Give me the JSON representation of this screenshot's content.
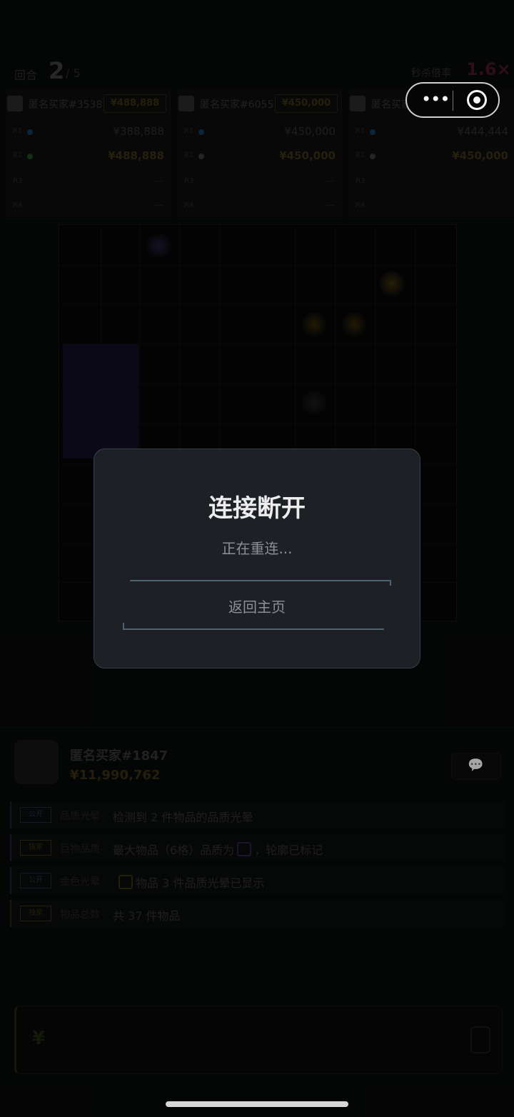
{
  "header": {
    "round_label": "回合",
    "round_current": "2",
    "round_total": "/ 5",
    "multiplier_label": "秒杀倍率",
    "multiplier_value": "1.6×"
  },
  "buyers": [
    {
      "name": "匿名买家#3538",
      "bid": "¥488,888",
      "rows": [
        {
          "label": "R1",
          "value": "¥388,888",
          "dot_color": "#0f3a5a"
        },
        {
          "label": "R2",
          "value": "¥488,888",
          "dot_color": "#1a4a1a"
        },
        {
          "label": "R3",
          "value": "—"
        },
        {
          "label": "R4",
          "value": "—"
        }
      ]
    },
    {
      "name": "匿名买家#6055",
      "bid": "¥450,000",
      "rows": [
        {
          "label": "R1",
          "value": "¥450,000",
          "dot_color": "#0f3a5a"
        },
        {
          "label": "R2",
          "value": "¥450,000",
          "dot_color": "#3a3a3a"
        },
        {
          "label": "R3",
          "value": "—"
        },
        {
          "label": "R4",
          "value": "—"
        }
      ]
    },
    {
      "name": "匿名买家",
      "bid": "",
      "rows": [
        {
          "label": "R1",
          "value": "¥444,444",
          "dot_color": "#0f3a5a"
        },
        {
          "label": "R2",
          "value": "¥450,000",
          "dot_color": "#3a3a3a"
        },
        {
          "label": "R3",
          "value": ""
        },
        {
          "label": "R4",
          "value": ""
        }
      ]
    }
  ],
  "player": {
    "name": "匿名买家#1847",
    "money": "¥11,990,762",
    "chat_icon": "chat-bubble-icon"
  },
  "info_rows": [
    {
      "tag": "公开",
      "category": "品质光晕",
      "text": "检测到 2 件物品的品质光晕",
      "tag_style": "blue"
    },
    {
      "tag": "独家",
      "category": "巨物品质",
      "text_before": "最大物品（6格）品质为",
      "text_after": "，轮廓已标记",
      "tag_style": "gold",
      "box_color": "#2a2344"
    },
    {
      "tag": "公开",
      "category": "金色光晕",
      "text_after": "物品 3 件品质光晕已显示",
      "tag_style": "blue",
      "box_color": "#3a3010"
    },
    {
      "tag": "独家",
      "category": "物品总数",
      "text": "共 37 件物品",
      "tag_style": "gold"
    }
  ],
  "bid_input": {
    "currency_symbol": "¥",
    "value": ""
  },
  "capsule": {
    "more_icon": "more-dots-icon",
    "close_icon": "target-circle-icon"
  },
  "modal": {
    "title": "连接断开",
    "subtitle": "正在重连...",
    "return_label": "返回主页"
  }
}
